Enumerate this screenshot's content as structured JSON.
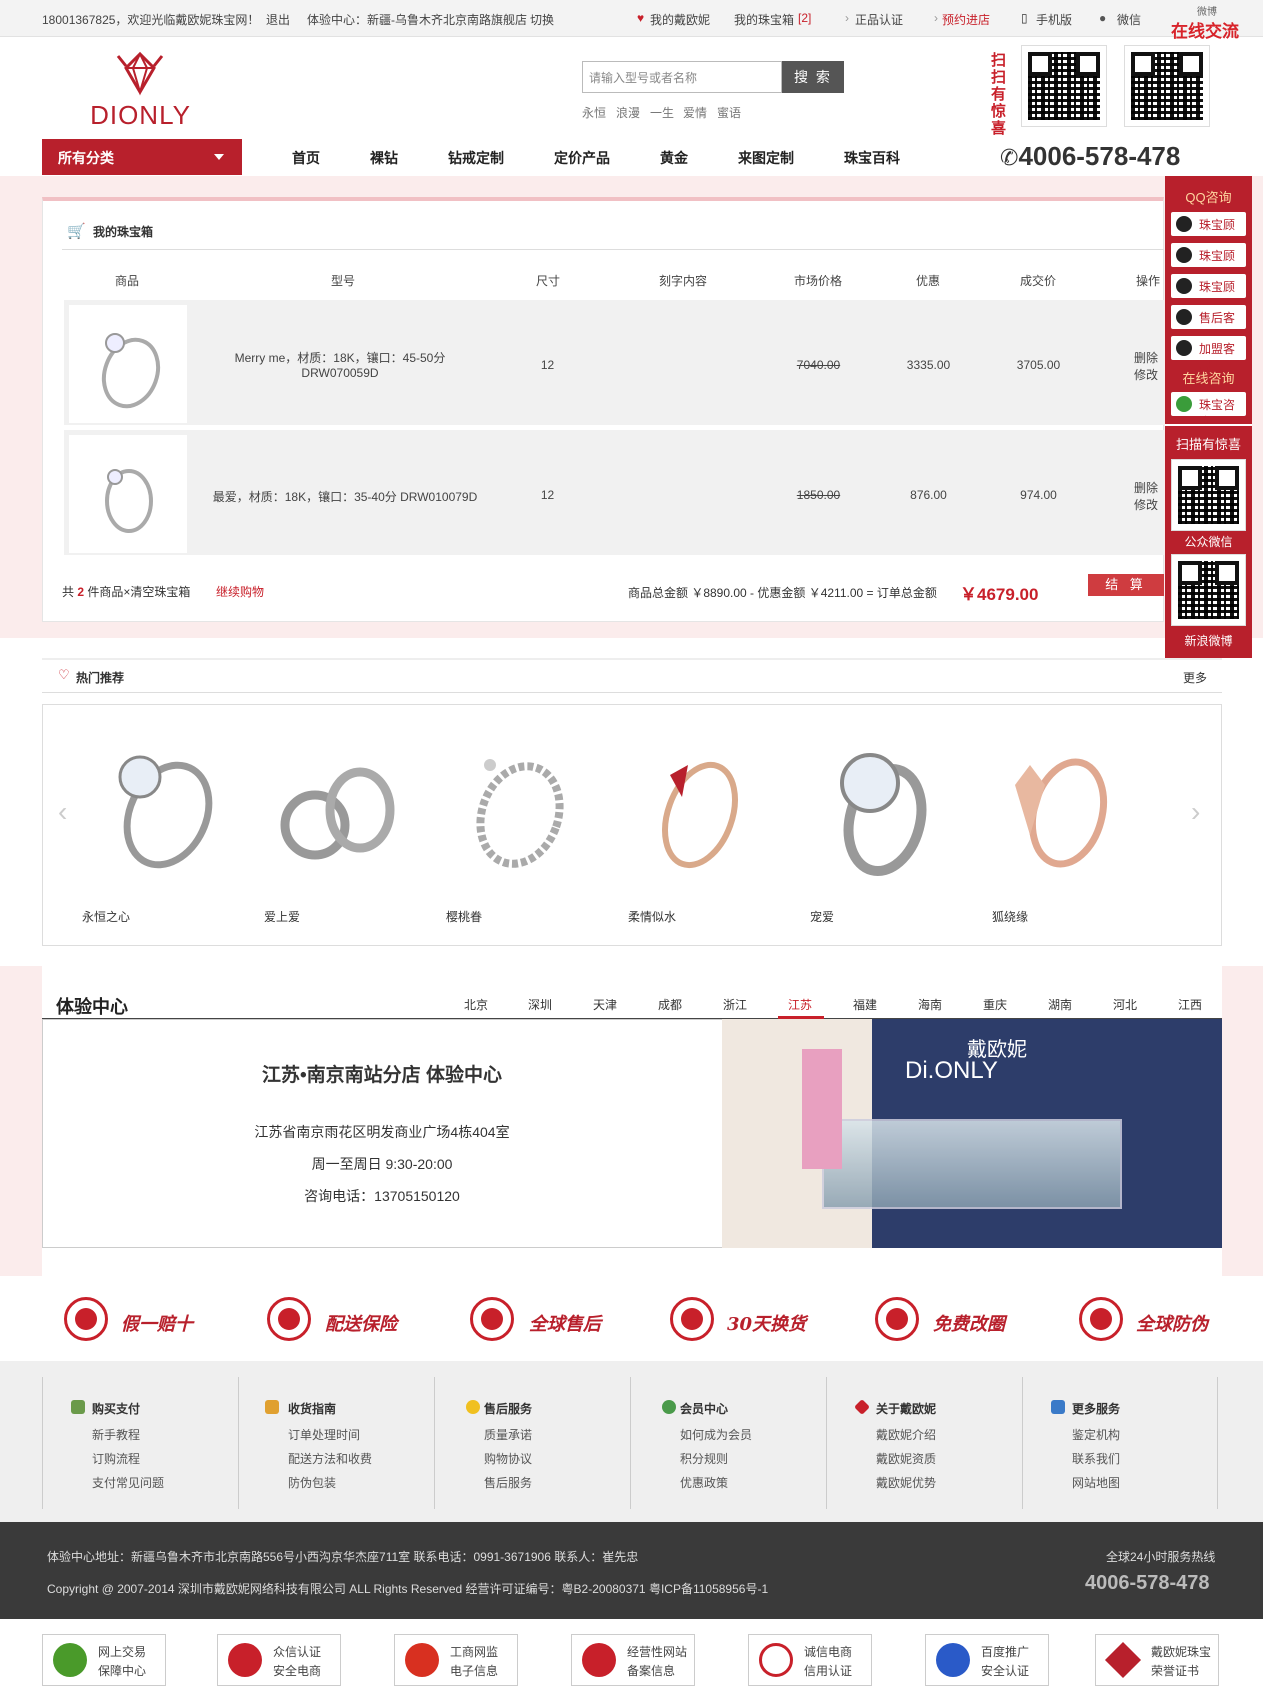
{
  "topbar": {
    "welcome": "18001367825，欢迎光临戴欧妮珠宝网！",
    "logout": "退出",
    "center": "体验中心：新疆-乌鲁木齐北京南路旗舰店",
    "switch": "切换",
    "my": "我的戴欧妮",
    "cart": "我的珠宝箱",
    "cart_count": "[2]",
    "auth": "正品认证",
    "appoint": "预约进店",
    "mobile": "手机版",
    "wechat": "微信",
    "weibo": "微博",
    "online": "在线交流"
  },
  "header": {
    "logo_text": "DIONLY",
    "search_placeholder": "请输入型号或者名称",
    "search_button": "搜 索",
    "hot_words": [
      "永恒",
      "浪漫",
      "一生",
      "爱情",
      "蜜语"
    ],
    "scan_label": "扫扫有惊喜",
    "phone": "4006-578-478"
  },
  "nav": {
    "all_categories": "所有分类",
    "items": [
      "首页",
      "裸钻",
      "钻戒定制",
      "定价产品",
      "黄金",
      "来图定制",
      "珠宝百科"
    ]
  },
  "cart": {
    "title": "我的珠宝箱",
    "columns": [
      "商品",
      "型号",
      "尺寸",
      "刻字内容",
      "市场价格",
      "优惠",
      "成交价",
      "操作"
    ],
    "rows": [
      {
        "model": "Merry me，材质：18K，镶口：45-50分",
        "code": "DRW070059D",
        "size": "12",
        "market": "7040.00",
        "discount": "3335.00",
        "price": "3705.00",
        "del": "删除",
        "edit": "修改"
      },
      {
        "model": "最爱，材质：18K，镶口：35-40分 DRW010079D",
        "code": "",
        "size": "12",
        "market": "1850.00",
        "discount": "876.00",
        "price": "974.00",
        "del": "删除",
        "edit": "修改"
      }
    ],
    "total_prefix": "共",
    "total_count": "2",
    "total_suffix": "件商品×清空珠宝箱",
    "continue": "继续购物",
    "summary": "商品总金额 ￥8890.00 - 优惠金额 ￥4211.00 = 订单总金额",
    "grand_total": "￥4679.00",
    "checkout": "结 算"
  },
  "sidebar": {
    "qq_title": "QQ咨询",
    "buttons": [
      "珠宝顾问",
      "珠宝顾问",
      "珠宝顾问",
      "售后客服",
      "加盟客服"
    ],
    "online_title": "在线咨询",
    "online_button": "珠宝咨询",
    "scan_title": "扫描有惊喜",
    "wechat_label": "公众微信",
    "weibo_label": "新浪微博"
  },
  "hot": {
    "title": "热门推荐",
    "more": "更多",
    "products": [
      "永恒之心",
      "爱上爱",
      "樱桃眷",
      "柔情似水",
      "宠爱",
      "狐绕缘"
    ]
  },
  "stores": {
    "title": "体验中心",
    "cities": [
      "北京",
      "深圳",
      "天津",
      "成都",
      "浙江",
      "江苏",
      "福建",
      "海南",
      "重庆",
      "湖南",
      "河北",
      "江西"
    ],
    "active_city": "江苏",
    "store_name": "江苏•南京南站分店 体验中心",
    "address": "江苏省南京雨花区明发商业广场4栋404室",
    "hours": "周一至周日 9:30-20:00",
    "phone": "咨询电话：13705150120",
    "photo_sign_cn": "戴欧妮",
    "photo_sign_en": "Di.ONLY"
  },
  "guarantees": [
    "假一赔十",
    "配送保险",
    "全球售后",
    "30天换货",
    "免费改圈",
    "全球防伪"
  ],
  "footer": {
    "columns": [
      {
        "title": "购买支付",
        "links": [
          "新手教程",
          "订购流程",
          "支付常见问题"
        ]
      },
      {
        "title": "收货指南",
        "links": [
          "订单处理时间",
          "配送方法和收费",
          "防伪包装"
        ]
      },
      {
        "title": "售后服务",
        "links": [
          "质量承诺",
          "购物协议",
          "售后服务"
        ]
      },
      {
        "title": "会员中心",
        "links": [
          "如何成为会员",
          "积分规则",
          "优惠政策"
        ]
      },
      {
        "title": "关于戴欧妮",
        "links": [
          "戴欧妮介绍",
          "戴欧妮资质",
          "戴欧妮优势"
        ]
      },
      {
        "title": "更多服务",
        "links": [
          "鉴定机构",
          "联系我们",
          "网站地图"
        ]
      }
    ],
    "address": "体验中心地址：新疆乌鲁木齐市北京南路556号小西沟京华杰座711室 联系电话：0991-3671906 联系人：崔先忠",
    "copyright": "Copyright @ 2007-2014 深圳市戴欧妮网络科技有限公司 ALL Rights Reserved 经营许可证编号：粤B2-20080371 粤ICP备11058956号-1",
    "hotline_label": "全球24小时服务热线",
    "hotline": "4006-578-478",
    "badges": [
      {
        "l1": "网上交易",
        "l2": "保障中心"
      },
      {
        "l1": "众信认证",
        "l2": "安全电商"
      },
      {
        "l1": "工商网监",
        "l2": "电子信息"
      },
      {
        "l1": "经营性网站",
        "l2": "备案信息"
      },
      {
        "l1": "诚信电商",
        "l2": "信用认证"
      },
      {
        "l1": "百度推广",
        "l2": "安全认证"
      },
      {
        "l1": "戴欧妮珠宝",
        "l2": "荣誉证书"
      }
    ]
  },
  "colors": {
    "brand": "#b8202c",
    "accent": "#cf3c40",
    "band": "#fbecec",
    "footer_dark": "#3a3a3a"
  }
}
